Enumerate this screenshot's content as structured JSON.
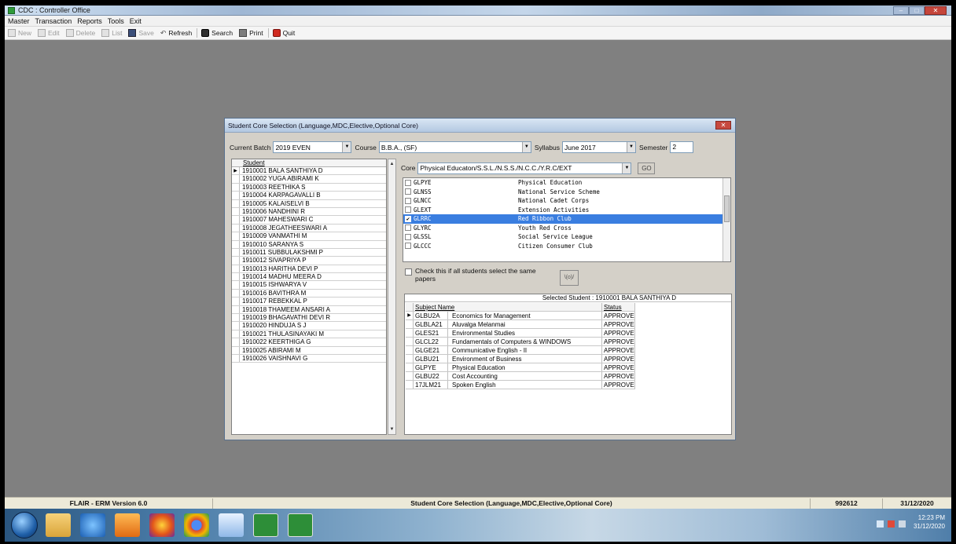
{
  "window": {
    "title": "CDC : Controller Office",
    "buttons": {
      "minimize": "–",
      "maximize": "□",
      "close": "✕"
    }
  },
  "menu": [
    "Master",
    "Transaction",
    "Reports",
    "Tools",
    "Exit"
  ],
  "toolbar": {
    "new": "New",
    "edit": "Edit",
    "delete": "Delete",
    "list": "List",
    "save": "Save",
    "refresh": "Refresh",
    "search": "Search",
    "print": "Print",
    "quit": "Quit"
  },
  "dialog": {
    "title": "Student Core Selection (Language,MDC,Elective,Optional Core)",
    "close": "✕",
    "batch_label": "Current Batch",
    "batch_value": "2019 EVEN",
    "course_label": "Course",
    "course_value": "B.B.A., (SF)",
    "syllabus_label": "Syllabus",
    "syllabus_value": "June 2017",
    "semester_label": "Semester",
    "semester_value": "2",
    "core_label": "Core",
    "core_value": "Physical Educaton/S.S.L./N.S.S./N.C.C./Y.R.C/EXT",
    "go_label": "GO",
    "check_all_text": "Check this if all students select the same papers",
    "all_btn": "\\(o)/",
    "selected_caption": "Selected Student : 1910001 BALA SANTHIYA D",
    "subject_header_name": "Subject Name",
    "subject_header_status": "Status"
  },
  "students": {
    "header": "Student",
    "rows": [
      "1910001 BALA SANTHIYA D",
      "1910002 YUGA ABIRAMI K",
      "1910003 REETHIKA S",
      "1910004 KARPAGAVALLI B",
      "1910005 KALAISELVI B",
      "1910006 NANDHINI R",
      "1910007 MAHESWARI C",
      "1910008 JEGATHEESWARI A",
      "1910009 VANMATHI M",
      "1910010 SARANYA S",
      "1910011 SUBBULAKSHMI P",
      "1910012 SIVAPRIYA P",
      "1910013 HARITHA DEVI P",
      "1910014 MADHU MEERA D",
      "1910015 ISHWARYA V",
      "1910016 BAVITHRA M",
      "1910017 REBEKKAL P",
      "1910018 THAMEEM ANSARI A",
      "1910019 BHAGAVATHI DEVI R",
      "1910020 HINDUJA S J",
      "1910021 THULASINAYAKI M",
      "1910022 KEERTHIGA G",
      "1910025 ABIRAMI M",
      "1910026 VAISHNAVI G"
    ]
  },
  "cores": [
    {
      "code": "GLPYE",
      "name": "Physical Education",
      "checked": false,
      "selected": false
    },
    {
      "code": "GLNSS",
      "name": "National Service Scheme",
      "checked": false,
      "selected": false
    },
    {
      "code": "GLNCC",
      "name": "National Cadet Corps",
      "checked": false,
      "selected": false
    },
    {
      "code": "GLEXT",
      "name": "Extension Activities",
      "checked": false,
      "selected": false
    },
    {
      "code": "GLRRC",
      "name": "Red Ribbon Club",
      "checked": true,
      "selected": true
    },
    {
      "code": "GLYRC",
      "name": "Youth Red Cross",
      "checked": false,
      "selected": false
    },
    {
      "code": "GLSSL",
      "name": "Social Service League",
      "checked": false,
      "selected": false
    },
    {
      "code": "GLCCC",
      "name": "Citizen Consumer Club",
      "checked": false,
      "selected": false
    }
  ],
  "subjects": [
    {
      "code": "GLBU2A",
      "name": "Economics for Management",
      "status": "APPROVED"
    },
    {
      "code": "GLBLA21",
      "name": "Aluvalga Melanmai",
      "status": "APPROVED"
    },
    {
      "code": "GLES21",
      "name": "Environmental Studies",
      "status": "APPROVED"
    },
    {
      "code": "GLCL22",
      "name": "Fundamentals of Computers & WINDOWS",
      "status": "APPROVED"
    },
    {
      "code": "GLGE21",
      "name": "Communicative English - II",
      "status": "APPROVED"
    },
    {
      "code": "GLBU21",
      "name": "Environment of Business",
      "status": "APPROVED"
    },
    {
      "code": "GLPYE",
      "name": "Physical Education",
      "status": "APPROVED"
    },
    {
      "code": "GLBU22",
      "name": "Cost Accounting",
      "status": "APPROVED"
    },
    {
      "code": "17JLM21",
      "name": "Spoken English",
      "status": "APPROVED"
    }
  ],
  "statusbar": {
    "app_version": "FLAIR - ERM Version 6.0",
    "form_name": "Student Core Selection (Language,MDC,Elective,Optional Core)",
    "code": "992612",
    "date": "31/12/2020"
  },
  "taskbar": {
    "time": "12:23 PM",
    "date": "31/12/2020",
    "apps": [
      "windows-explorer",
      "internet-explorer",
      "media-player",
      "firefox",
      "chrome",
      "notepad",
      "flair-app",
      "flair-app-2"
    ]
  },
  "colors": {
    "selection": "#3a7ee0",
    "desktop": "#808080",
    "dialog": "#d4d0c8"
  }
}
